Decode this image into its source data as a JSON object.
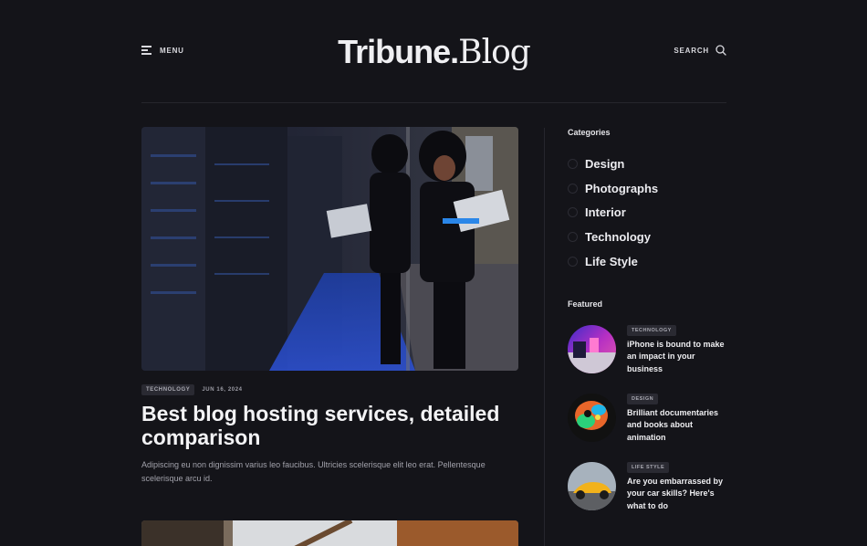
{
  "header": {
    "menu_label": "MENU",
    "logo_main": "Tribune.",
    "logo_sub": "Blog",
    "search_label": "SEARCH"
  },
  "main_post": {
    "tag": "TECHNOLOGY",
    "date": "JUN 16, 2024",
    "title": "Best blog hosting services, detailed comparison",
    "excerpt": "Adipiscing eu non dignissim varius leo faucibus. Ultricies scelerisque elit leo erat. Pellentesque scelerisque arcu id.",
    "image": "woman-with-laptop-in-server-room"
  },
  "sidebar": {
    "categories_heading": "Categories",
    "categories": [
      "Design",
      "Photographs",
      "Interior",
      "Technology",
      "Life Style"
    ],
    "featured_heading": "Featured",
    "featured": [
      {
        "tag": "TECHNOLOGY",
        "title": "iPhone is bound to make an impact in your business",
        "image": "neon-room"
      },
      {
        "tag": "DESIGN",
        "title": "Brilliant documentaries and books about animation",
        "image": "colorful-skull-art"
      },
      {
        "tag": "LIFE STYLE",
        "title": "Are you embarrassed by your car skills? Here's what to do",
        "image": "yellow-sports-car"
      }
    ]
  },
  "icons": {
    "menu": "hamburger-icon",
    "search": "search-icon"
  }
}
